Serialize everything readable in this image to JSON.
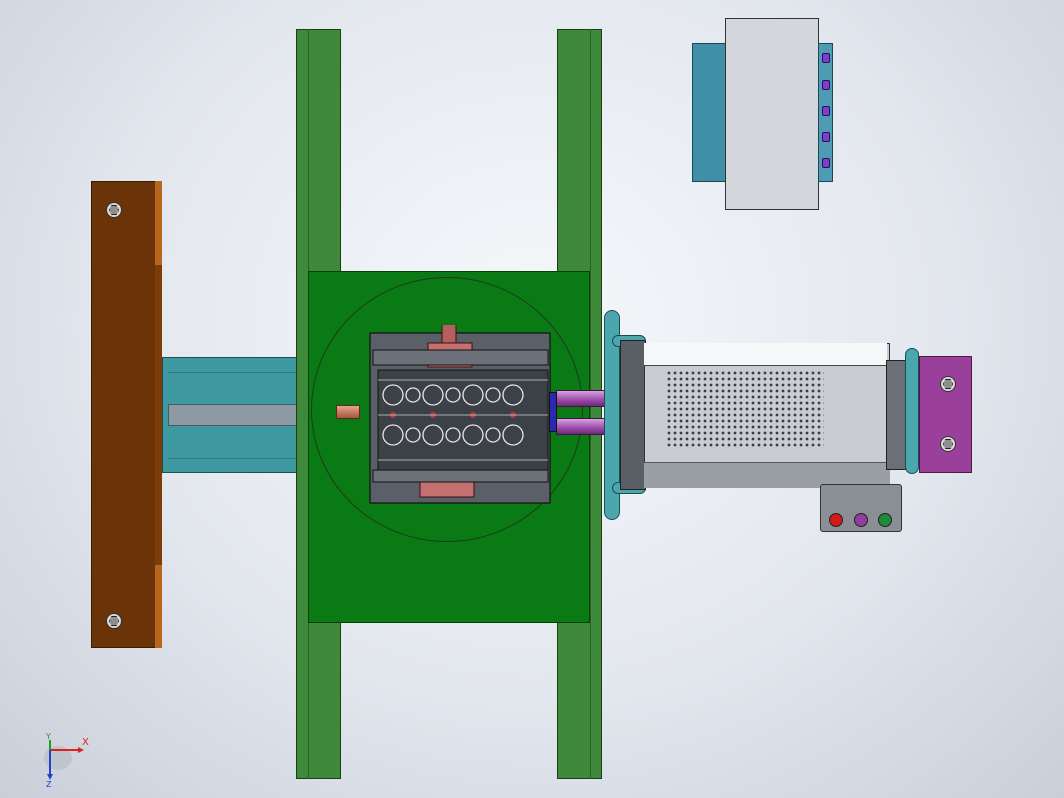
{
  "viewport": {
    "triad": {
      "x_label": "X",
      "y_label": "Y",
      "z_label": "Z"
    }
  },
  "colors": {
    "background": "#e3e7ee",
    "frame_green": "#3f8a3a",
    "plate_green": "#0a7a14",
    "bracket_brown": "#6b3408",
    "teal": "#3e9aa0",
    "purple": "#9a3f9a"
  },
  "control_box": {
    "buttons": [
      {
        "name": "red-button",
        "color": "#d11a1a"
      },
      {
        "name": "purple-button",
        "color": "#8e3fa0"
      },
      {
        "name": "green-button",
        "color": "#1f8a3a"
      }
    ]
  },
  "icons": [
    "hex-bolt-icon",
    "axis-triad-icon"
  ]
}
